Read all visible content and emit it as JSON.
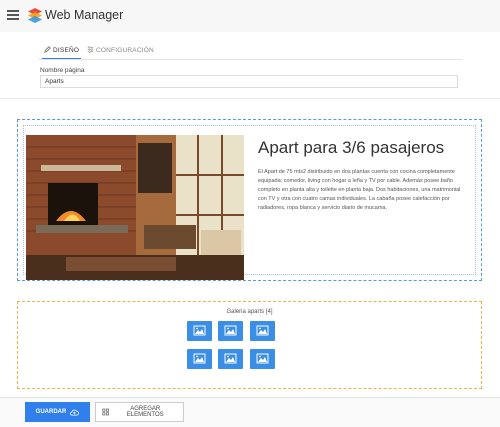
{
  "app": {
    "title": "Web Manager"
  },
  "tabs": {
    "design": "DISEÑO",
    "config": "CONFIGURACIÓN"
  },
  "form": {
    "page_name_label": "Nombre página",
    "page_name_value": "Aparts"
  },
  "content": {
    "heading": "Apart para 3/6 pasajeros",
    "description": "El Apart de 75 mts2 distribuido en dos plantas cuenta con cocina completamente equipada; comedor, living con hogar a leña y TV por cable. Además posee baño completo en planta alta y toilette en planta baja. Dos habitaciones, una matrimonial con TV y otra con cuatro camas individuales. La cabaña posee calefacción por radiadores, ropa blanca y servicio diario de mucama."
  },
  "gallery": {
    "label": "Galeria aparts [4]",
    "thumb_count": 6
  },
  "actions": {
    "save": "GUARDAR",
    "add": "AGREGAR ELEMENTOS"
  },
  "colors": {
    "accent": "#2f80ed",
    "thumb": "#3a8ee6",
    "section_blue": "#5b9bd5",
    "section_orange": "#f0b24b"
  },
  "icons": [
    "menu-icon",
    "app-logo",
    "pencil-icon",
    "settings-sliders-icon",
    "image-icon",
    "cloud-upload-icon",
    "grid-icon"
  ]
}
